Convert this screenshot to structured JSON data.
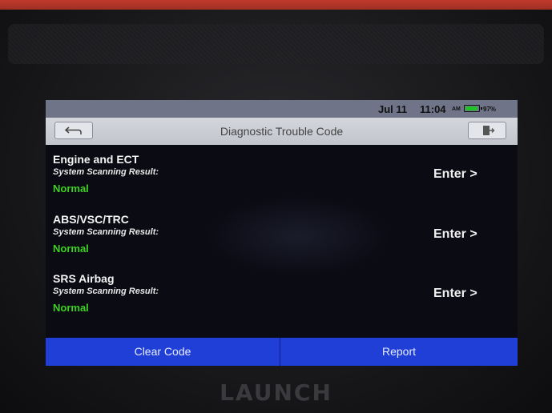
{
  "status_bar": {
    "date": "Jul 11",
    "time": "11:04",
    "ampm": "AM",
    "battery": "97%",
    "battery_color": "#22c12a"
  },
  "header": {
    "title": "Diagnostic Trouble Code",
    "back_icon": "back-arrow-icon",
    "exit_icon": "exit-icon"
  },
  "systems": [
    {
      "name": "Engine and ECT",
      "label": "System Scanning Result:",
      "status": "Normal",
      "action": "Enter >"
    },
    {
      "name": "ABS/VSC/TRC",
      "label": "System Scanning Result:",
      "status": "Normal",
      "action": "Enter >"
    },
    {
      "name": "SRS Airbag",
      "label": "System Scanning Result:",
      "status": "Normal",
      "action": "Enter >"
    }
  ],
  "footer": {
    "clear_code": "Clear Code",
    "report": "Report"
  },
  "colors": {
    "status_normal": "#3bd11f",
    "action_bar": "#1f3fd6"
  },
  "brand": "LAUNCH"
}
